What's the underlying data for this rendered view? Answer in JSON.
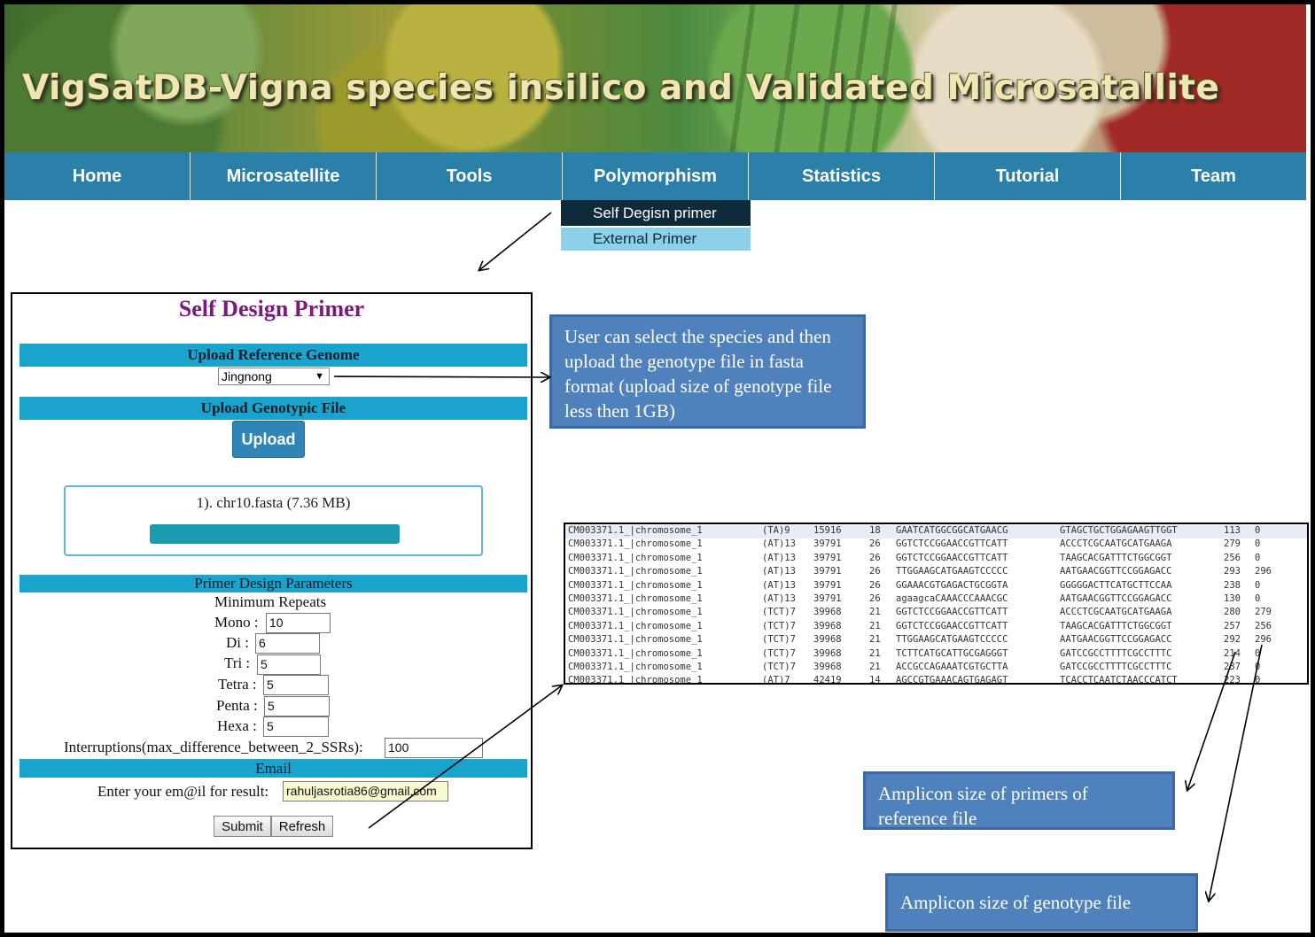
{
  "banner": {
    "title": "VigSatDB-Vigna species insilico and Validated Microsatallite"
  },
  "nav": {
    "items": [
      "Home",
      "Microsatellite",
      "Tools",
      "Polymorphism",
      "Statistics",
      "Tutorial",
      "Team"
    ],
    "submenu": [
      "Self Degisn primer",
      "External Primer"
    ]
  },
  "form": {
    "title": "Self Design Primer",
    "reference_header": "Upload Reference Genome",
    "genome_selected": "Jingnong",
    "genotypic_header": "Upload Genotypic File",
    "upload_label": "Upload",
    "file_label": "1). chr10.fasta (7.36 MB)",
    "upload_progress_percent": 100,
    "params_header": "Primer Design Parameters",
    "min_repeats_label": "Minimum Repeats",
    "mono_label": "Mono :",
    "mono_value": "10",
    "di_label": "Di :",
    "di_value": "6",
    "tri_label": "Tri :",
    "tri_value": "5",
    "tetra_label": "Tetra :",
    "tetra_value": "5",
    "penta_label": "Penta :",
    "penta_value": "5",
    "hexa_label": "Hexa :",
    "hexa_value": "5",
    "interruptions_label": "Interruptions(max_difference_between_2_SSRs):",
    "interruptions_value": "100",
    "email_header": "Email",
    "email_label": "Enter your em@il for result:",
    "email_value": "rahuljasrotia86@gmail.com",
    "submit_label": "Submit",
    "refresh_label": "Refresh"
  },
  "callouts": {
    "species": "User can select the species and then upload the genotype file in fasta format (upload size of genotype file less then 1GB)",
    "reference_amplicon": "Amplicon size of primers of reference file",
    "genotype_amplicon": "Amplicon size of genotype file"
  },
  "results": {
    "rows": [
      [
        "CM003371.1_|chromosome_1",
        "(TA)9",
        "15916",
        "18",
        "GAATCATGGCGGCATGAACG",
        "GTAGCTGCTGGAGAAGTTGGT",
        "113",
        "0"
      ],
      [
        "CM003371.1_|chromosome_1",
        "(AT)13",
        "39791",
        "26",
        "GGTCTCCGGAACCGTTCATT",
        "ACCCTCGCAATGCATGAAGA",
        "279",
        "0"
      ],
      [
        "CM003371.1_|chromosome_1",
        "(AT)13",
        "39791",
        "26",
        "GGTCTCCGGAACCGTTCATT",
        "TAAGCACGATTTCTGGCGGT",
        "256",
        "0"
      ],
      [
        "CM003371.1_|chromosome_1",
        "(AT)13",
        "39791",
        "26",
        "TTGGAAGCATGAAGTCCCCC",
        "AATGAACGGTTCCGGAGACC",
        "293",
        "296"
      ],
      [
        "CM003371.1_|chromosome_1",
        "(AT)13",
        "39791",
        "26",
        "GGAAACGTGAGACTGCGGTA",
        "GGGGGACTTCATGCTTCCAA",
        "238",
        "0"
      ],
      [
        "CM003371.1_|chromosome_1",
        "(AT)13",
        "39791",
        "26",
        "agaagcaCAAACCCAAACGC",
        "AATGAACGGTTCCGGAGACC",
        "130",
        "0"
      ],
      [
        "CM003371.1_|chromosome_1",
        "(TCT)7",
        "39968",
        "21",
        "GGTCTCCGGAACCGTTCATT",
        "ACCCTCGCAATGCATGAAGA",
        "280",
        "279"
      ],
      [
        "CM003371.1_|chromosome_1",
        "(TCT)7",
        "39968",
        "21",
        "GGTCTCCGGAACCGTTCATT",
        "TAAGCACGATTTCTGGCGGT",
        "257",
        "256"
      ],
      [
        "CM003371.1_|chromosome_1",
        "(TCT)7",
        "39968",
        "21",
        "TTGGAAGCATGAAGTCCCCC",
        "AATGAACGGTTCCGGAGACC",
        "292",
        "296"
      ],
      [
        "CM003371.1_|chromosome_1",
        "(TCT)7",
        "39968",
        "21",
        "TCTTCATGCATTGCGAGGGT",
        "GATCCGCCTTTTCGCCTTTC",
        "214",
        "0"
      ],
      [
        "CM003371.1_|chromosome_1",
        "(TCT)7",
        "39968",
        "21",
        "ACCGCCAGAAATCGTGCTTA",
        "GATCCGCCTTTTCGCCTTTC",
        "237",
        "0"
      ],
      [
        "CM003371.1_|chromosome_1",
        "(AT)7",
        "42419",
        "14",
        "AGCCGTGAAACAGTGAGAGT",
        "TCACCTCAATCTAACCCATCT",
        "223",
        "0"
      ]
    ]
  },
  "colors": {
    "nav": "#2b80aa",
    "bar": "#1aa3cc",
    "callout": "#4f81bd",
    "title": "#7b1a7b",
    "progress": "#1a9bb0"
  }
}
